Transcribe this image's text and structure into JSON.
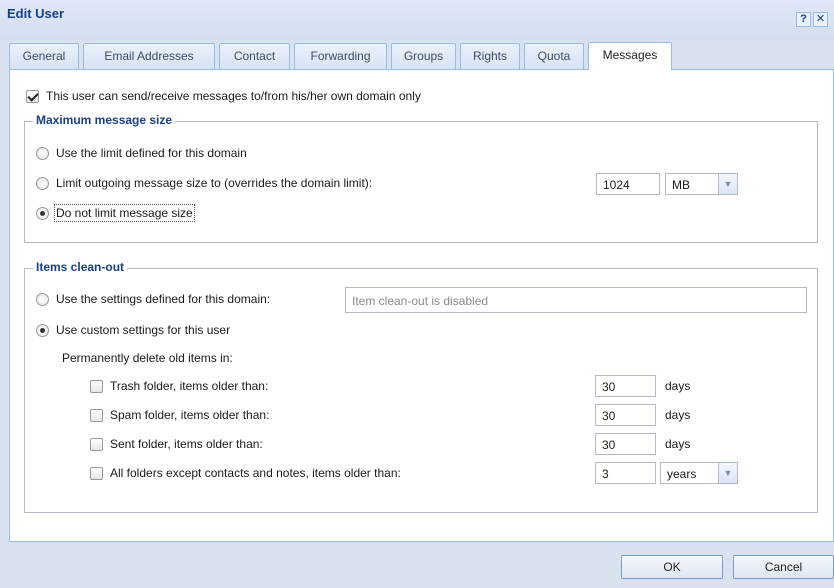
{
  "window": {
    "title": "Edit User",
    "help_glyph": "?",
    "close_glyph": "✕"
  },
  "tabs": [
    {
      "label": "General"
    },
    {
      "label": "Email Addresses"
    },
    {
      "label": "Contact"
    },
    {
      "label": "Forwarding"
    },
    {
      "label": "Groups"
    },
    {
      "label": "Rights"
    },
    {
      "label": "Quota"
    },
    {
      "label": "Messages",
      "active": true
    }
  ],
  "messages": {
    "own_domain_only": {
      "label": "This user can send/receive messages to/from his/her own domain only",
      "checked": true
    },
    "max_size": {
      "legend": "Maximum message size",
      "options": [
        {
          "label": "Use the limit defined for this domain",
          "checked": false
        },
        {
          "label": "Limit outgoing message size to (overrides the domain limit):",
          "checked": false
        },
        {
          "label": "Do not limit message size",
          "checked": true
        }
      ],
      "limit_value": "1024",
      "limit_unit": "MB"
    },
    "cleanout": {
      "legend": "Items clean-out",
      "domain_option": {
        "label": "Use the settings defined for this domain:",
        "checked": false
      },
      "domain_status": "Item clean-out is disabled",
      "custom_option": {
        "label": "Use custom settings for this user",
        "checked": true
      },
      "permanent_label": "Permanently delete old items in:",
      "items": [
        {
          "label": "Trash folder, items older than:",
          "value": "30",
          "unit": "days",
          "checked": false
        },
        {
          "label": "Spam folder, items older than:",
          "value": "30",
          "unit": "days",
          "checked": false
        },
        {
          "label": "Sent folder, items older than:",
          "value": "30",
          "unit": "days",
          "checked": false
        },
        {
          "label": "All folders except contacts and notes, items older than:",
          "value": "3",
          "unit": "years",
          "checked": false
        }
      ]
    }
  },
  "buttons": {
    "ok": "OK",
    "cancel": "Cancel"
  },
  "colors": {
    "accent": "#15428b",
    "arrow": "#e02020",
    "frame": "#d9e3f0"
  },
  "icons": {
    "help": "help-icon",
    "close": "close-icon",
    "dropdown": "chevron-down-icon",
    "pointer": "red-arrow-annotation"
  }
}
